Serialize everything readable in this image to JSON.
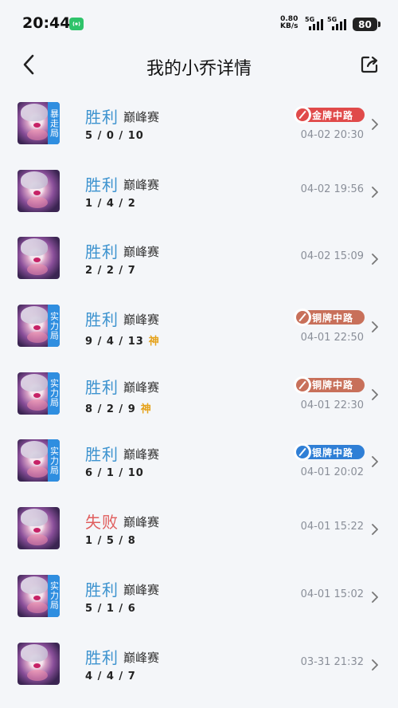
{
  "status_bar": {
    "time": "20:44",
    "net_speed_value": "0.80",
    "net_speed_unit": "KB/s",
    "signal1": "5G",
    "signal2": "5G",
    "battery": "80"
  },
  "header": {
    "title": "我的小乔详情"
  },
  "colors": {
    "win": "#3d93cf",
    "lose": "#e05d5d",
    "gold_badge": "#e04a4a",
    "bronze_badge": "#c8705a",
    "silver_badge": "#2f7fd6",
    "mode_tag": "#2f8ee0",
    "god_tag": "#e5a21b"
  },
  "matches": [
    {
      "result": "胜利",
      "outcome": "win",
      "type": "巅峰赛",
      "kda": "5 / 0 / 10",
      "god": "",
      "mode_tag": "暴走局",
      "lane_badge": "金牌中路",
      "badge_tier": "gold",
      "time": "04-02 20:30"
    },
    {
      "result": "胜利",
      "outcome": "win",
      "type": "巅峰赛",
      "kda": "1 / 4 / 2",
      "god": "",
      "mode_tag": "",
      "lane_badge": "",
      "badge_tier": "",
      "time": "04-02 19:56"
    },
    {
      "result": "胜利",
      "outcome": "win",
      "type": "巅峰赛",
      "kda": "2 / 2 / 7",
      "god": "",
      "mode_tag": "",
      "lane_badge": "",
      "badge_tier": "",
      "time": "04-02 15:09"
    },
    {
      "result": "胜利",
      "outcome": "win",
      "type": "巅峰赛",
      "kda": "9 / 4 / 13",
      "god": "神",
      "mode_tag": "实力局",
      "lane_badge": "铜牌中路",
      "badge_tier": "bronze",
      "time": "04-01 22:50"
    },
    {
      "result": "胜利",
      "outcome": "win",
      "type": "巅峰赛",
      "kda": "8 / 2 / 9",
      "god": "神",
      "mode_tag": "实力局",
      "lane_badge": "铜牌中路",
      "badge_tier": "bronze",
      "time": "04-01 22:30"
    },
    {
      "result": "胜利",
      "outcome": "win",
      "type": "巅峰赛",
      "kda": "6 / 1 / 10",
      "god": "",
      "mode_tag": "实力局",
      "lane_badge": "银牌中路",
      "badge_tier": "silver",
      "time": "04-01 20:02"
    },
    {
      "result": "失败",
      "outcome": "lose",
      "type": "巅峰赛",
      "kda": "1 / 5 / 8",
      "god": "",
      "mode_tag": "",
      "lane_badge": "",
      "badge_tier": "",
      "time": "04-01 15:22"
    },
    {
      "result": "胜利",
      "outcome": "win",
      "type": "巅峰赛",
      "kda": "5 / 1 / 6",
      "god": "",
      "mode_tag": "实力局",
      "lane_badge": "",
      "badge_tier": "",
      "time": "04-01 15:02"
    },
    {
      "result": "胜利",
      "outcome": "win",
      "type": "巅峰赛",
      "kda": "4 / 4 / 7",
      "god": "",
      "mode_tag": "",
      "lane_badge": "",
      "badge_tier": "",
      "time": "03-31 21:32"
    }
  ]
}
